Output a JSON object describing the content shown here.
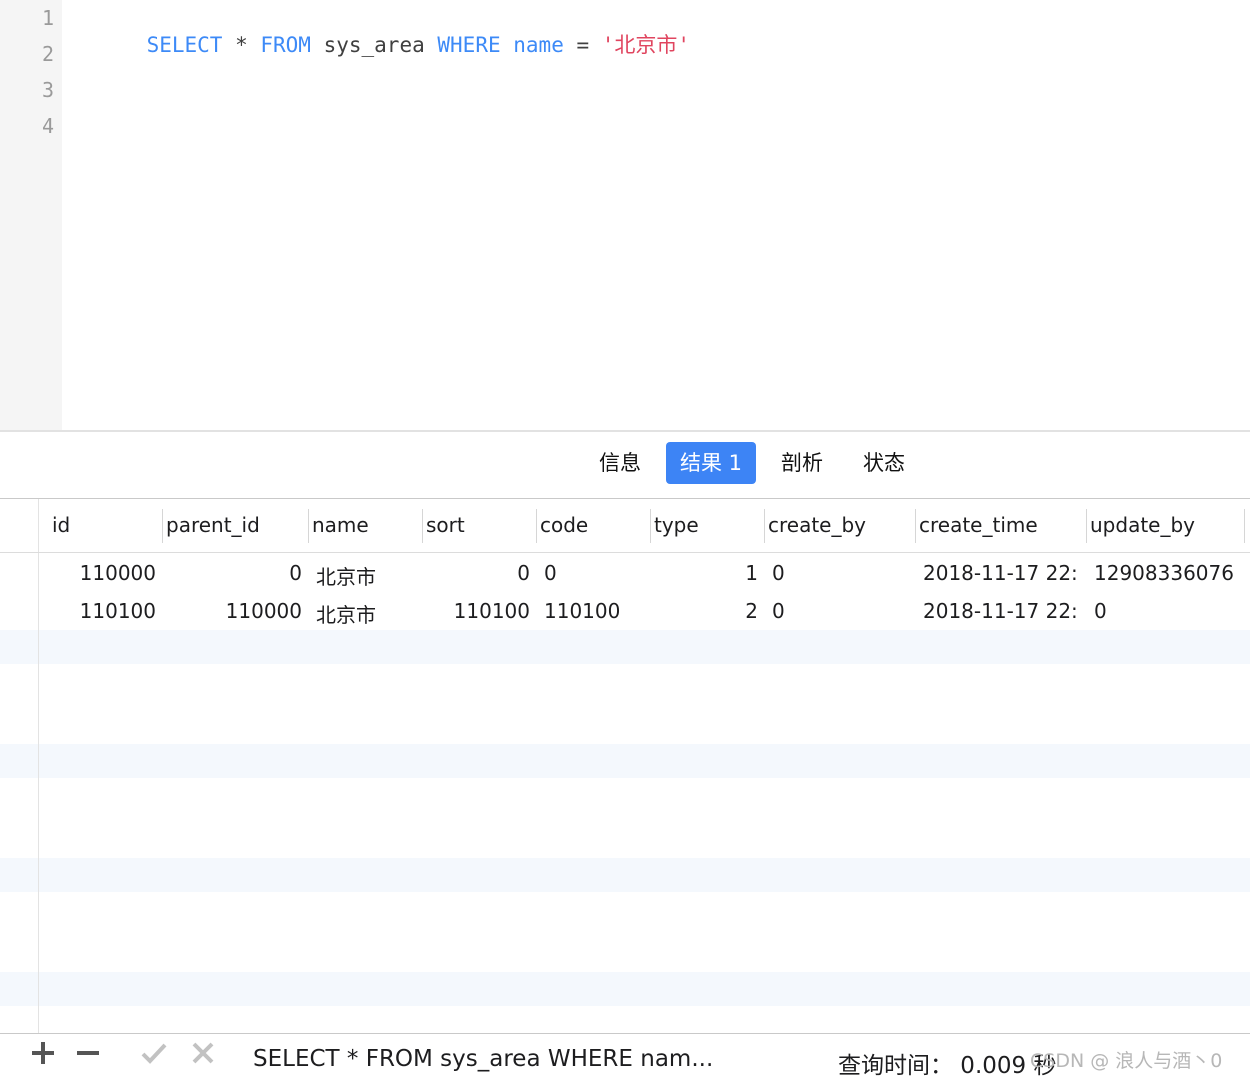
{
  "editor": {
    "line_numbers": [
      "1",
      "2",
      "3",
      "4"
    ],
    "sql_tokens": [
      {
        "text": "SELECT",
        "kind": "kw"
      },
      {
        "text": " * ",
        "kind": "plain"
      },
      {
        "text": "FROM",
        "kind": "kw"
      },
      {
        "text": " sys_area ",
        "kind": "plain"
      },
      {
        "text": "WHERE",
        "kind": "kw"
      },
      {
        "text": " ",
        "kind": "plain"
      },
      {
        "text": "name",
        "kind": "kw"
      },
      {
        "text": " = ",
        "kind": "plain"
      },
      {
        "text": "'北京市'",
        "kind": "str"
      }
    ]
  },
  "tabs": [
    {
      "label": "信息",
      "active": false
    },
    {
      "label": "结果 1",
      "active": true
    },
    {
      "label": "剖析",
      "active": false
    },
    {
      "label": "状态",
      "active": false
    }
  ],
  "grid": {
    "columns": [
      "id",
      "parent_id",
      "name",
      "sort",
      "code",
      "type",
      "create_by",
      "create_time",
      "update_by"
    ],
    "rows": [
      [
        "110000",
        "0",
        "北京市",
        "0",
        "0",
        "1",
        "0",
        "2018-11-17 22:",
        "12908336076"
      ],
      [
        "110100",
        "110000",
        "北京市",
        "110100",
        "110100",
        "2",
        "0",
        "2018-11-17 22:",
        "0"
      ]
    ]
  },
  "status_bar": {
    "add_icon": "plus-icon",
    "remove_icon": "minus-icon",
    "apply_icon": "check-icon",
    "discard_icon": "x-icon",
    "sql_text": "SELECT * FROM sys_area WHERE nam...",
    "query_time": "查询时间： 0.009 秒",
    "watermark": "CSDN @ 浪人与酒丶0"
  },
  "colors": {
    "keyword": "#3d8af7",
    "string": "#e0455f",
    "active_tab": "#3d84f5",
    "stripe": "#f4f8fd"
  }
}
